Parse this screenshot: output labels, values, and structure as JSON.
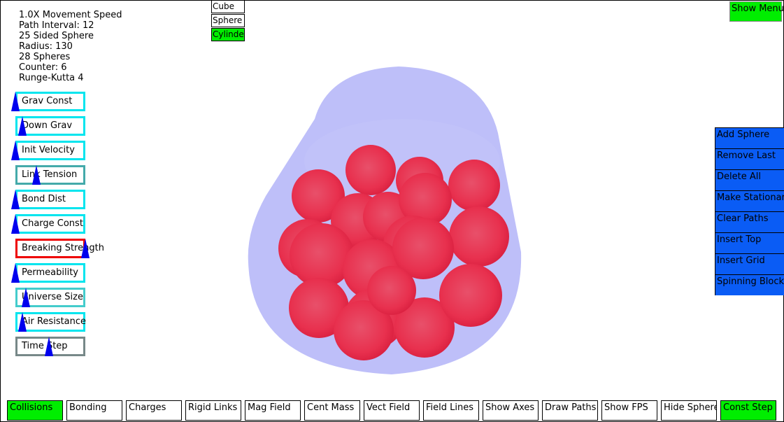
{
  "info": {
    "lines": [
      "1.0X Movement Speed",
      "Path Interval: 12",
      "25 Sided Sphere",
      "Radius: 130",
      "28 Spheres",
      "Counter: 6",
      "Runge-Kutta 4"
    ]
  },
  "shapes": [
    {
      "label": "Cube",
      "selected": false
    },
    {
      "label": "Sphere",
      "selected": false
    },
    {
      "label": "Cylinder",
      "selected": true
    }
  ],
  "show_menu": {
    "label": "Show Menu"
  },
  "params": [
    {
      "label": "Grav Const",
      "level": 0.0,
      "color": "#00e5ee"
    },
    {
      "label": "Down Grav",
      "level": 0.1,
      "color": "#00e5ee"
    },
    {
      "label": "Init Velocity",
      "level": 0.0,
      "color": "#00e5ee"
    },
    {
      "label": "Link Tension",
      "level": 0.3,
      "color": "#44aaaa"
    },
    {
      "label": "Bond Dist",
      "level": 0.0,
      "color": "#00e5ee"
    },
    {
      "label": "Charge Const",
      "level": 0.0,
      "color": "#00e5ee"
    },
    {
      "label": "Breaking Strength",
      "level": 1.0,
      "color": "#ee0000"
    },
    {
      "label": "Permeability",
      "level": 0.0,
      "color": "#00e5ee"
    },
    {
      "label": "Universe Size",
      "level": 0.15,
      "color": "#44cccc"
    },
    {
      "label": "Air Resistance",
      "level": 0.1,
      "color": "#00e5ee"
    },
    {
      "label": "Time Step",
      "level": 0.48,
      "color": "#778888"
    }
  ],
  "actions": [
    "Add Sphere",
    "Remove Last",
    "Delete All",
    "Make Stationary",
    "Clear Paths",
    "Insert Top",
    "Insert Grid",
    "Spinning Block"
  ],
  "toggles": [
    {
      "label": "Collisions",
      "on": true
    },
    {
      "label": "Bonding",
      "on": false
    },
    {
      "label": "Charges",
      "on": false
    },
    {
      "label": "Rigid Links",
      "on": false
    },
    {
      "label": "Mag Field",
      "on": false
    },
    {
      "label": "Cent Mass",
      "on": false
    },
    {
      "label": "Vect Field",
      "on": false
    },
    {
      "label": "Field Lines",
      "on": false
    },
    {
      "label": "Show Axes",
      "on": false
    },
    {
      "label": "Draw Paths",
      "on": false
    },
    {
      "label": "Show FPS",
      "on": false
    },
    {
      "label": "Hide Spheres",
      "on": false
    },
    {
      "label": "Const Step",
      "on": true
    }
  ],
  "colors": {
    "container": "#b8baf8",
    "sphere": "#e8304e",
    "toggle_on": "#00ee00",
    "action_bg": "#0a5cf5",
    "knob": "#0000ee"
  }
}
